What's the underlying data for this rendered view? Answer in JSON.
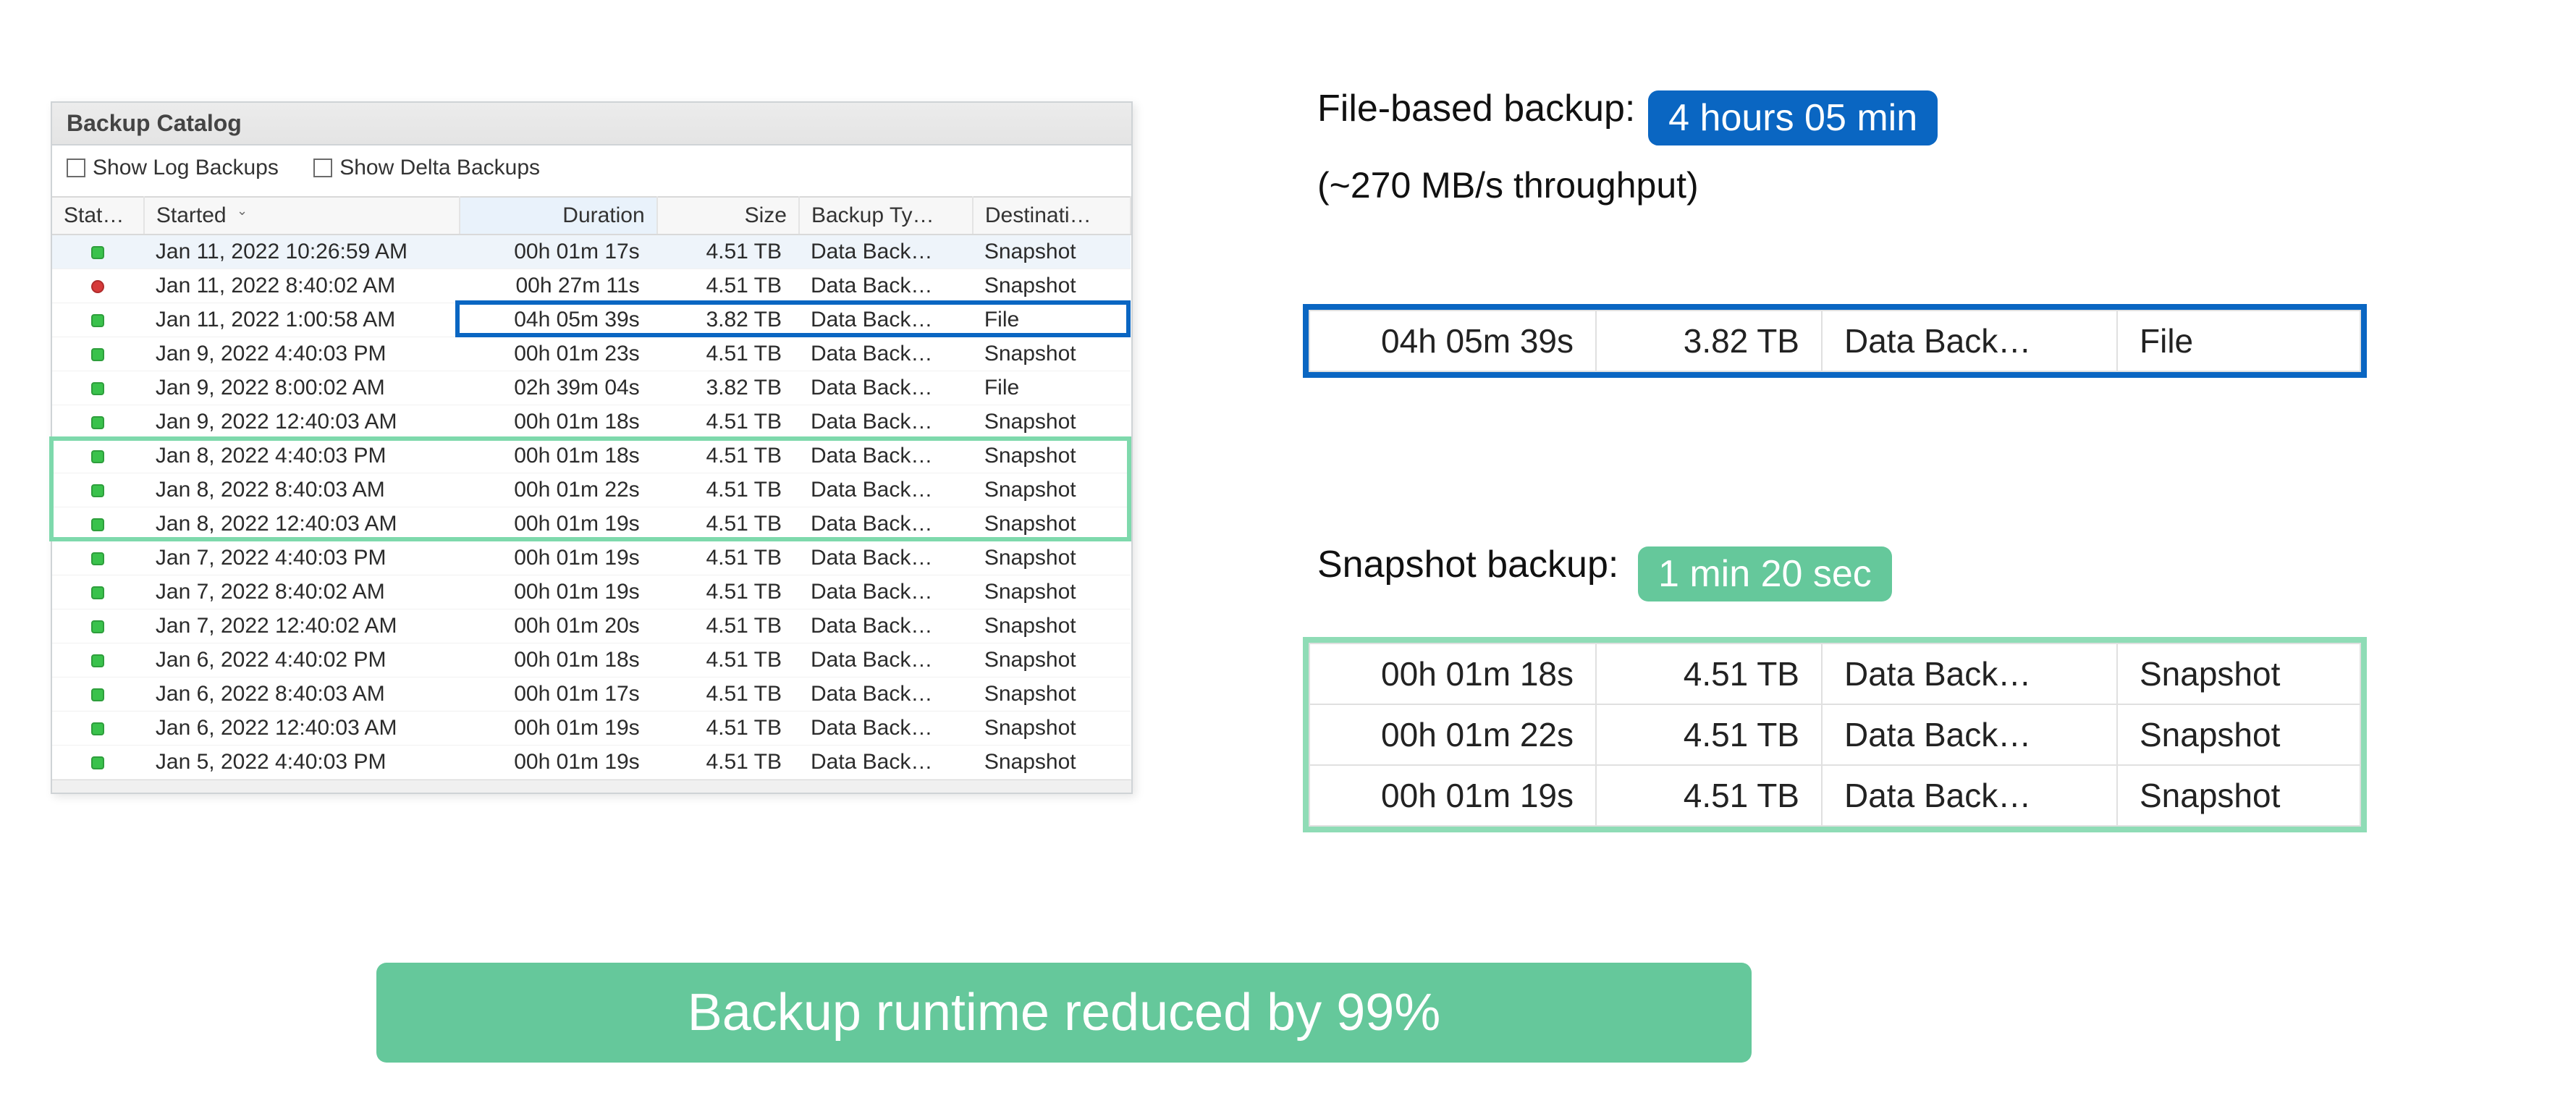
{
  "colors": {
    "blue": "#0a66c2",
    "green": "#65c89b",
    "green_light": "#8fdcb6"
  },
  "catalog": {
    "title": "Backup Catalog",
    "filters": {
      "show_log_backups": {
        "label": "Show Log Backups",
        "checked": false
      },
      "show_delta_backups": {
        "label": "Show Delta Backups",
        "checked": false
      }
    },
    "columns": {
      "status": "Stat…",
      "started": "Started",
      "duration": "Duration",
      "size": "Size",
      "backup_type": "Backup Ty…",
      "destination": "Destinati…"
    },
    "rows": [
      {
        "status": "ok",
        "started": "Jan 11, 2022 10:26:59 AM",
        "duration": "00h 01m 17s",
        "size": "4.51 TB",
        "type": "Data Back…",
        "dest": "Snapshot",
        "selected": true
      },
      {
        "status": "err",
        "started": "Jan 11, 2022 8:40:02 AM",
        "duration": "00h 27m 11s",
        "size": "4.51 TB",
        "type": "Data Back…",
        "dest": "Snapshot"
      },
      {
        "status": "ok",
        "started": "Jan 11, 2022 1:00:58 AM",
        "duration": "04h 05m 39s",
        "size": "3.82 TB",
        "type": "Data Back…",
        "dest": "File"
      },
      {
        "status": "ok",
        "started": "Jan 9, 2022 4:40:03 PM",
        "duration": "00h 01m 23s",
        "size": "4.51 TB",
        "type": "Data Back…",
        "dest": "Snapshot"
      },
      {
        "status": "ok",
        "started": "Jan 9, 2022 8:00:02 AM",
        "duration": "02h 39m 04s",
        "size": "3.82 TB",
        "type": "Data Back…",
        "dest": "File"
      },
      {
        "status": "ok",
        "started": "Jan 9, 2022 12:40:03 AM",
        "duration": "00h 01m 18s",
        "size": "4.51 TB",
        "type": "Data Back…",
        "dest": "Snapshot"
      },
      {
        "status": "ok",
        "started": "Jan 8, 2022 4:40:03 PM",
        "duration": "00h 01m 18s",
        "size": "4.51 TB",
        "type": "Data Back…",
        "dest": "Snapshot"
      },
      {
        "status": "ok",
        "started": "Jan 8, 2022 8:40:03 AM",
        "duration": "00h 01m 22s",
        "size": "4.51 TB",
        "type": "Data Back…",
        "dest": "Snapshot"
      },
      {
        "status": "ok",
        "started": "Jan 8, 2022 12:40:03 AM",
        "duration": "00h 01m 19s",
        "size": "4.51 TB",
        "type": "Data Back…",
        "dest": "Snapshot"
      },
      {
        "status": "ok",
        "started": "Jan 7, 2022 4:40:03 PM",
        "duration": "00h 01m 19s",
        "size": "4.51 TB",
        "type": "Data Back…",
        "dest": "Snapshot"
      },
      {
        "status": "ok",
        "started": "Jan 7, 2022 8:40:02 AM",
        "duration": "00h 01m 19s",
        "size": "4.51 TB",
        "type": "Data Back…",
        "dest": "Snapshot"
      },
      {
        "status": "ok",
        "started": "Jan 7, 2022 12:40:02 AM",
        "duration": "00h 01m 20s",
        "size": "4.51 TB",
        "type": "Data Back…",
        "dest": "Snapshot"
      },
      {
        "status": "ok",
        "started": "Jan 6, 2022 4:40:02 PM",
        "duration": "00h 01m 18s",
        "size": "4.51 TB",
        "type": "Data Back…",
        "dest": "Snapshot"
      },
      {
        "status": "ok",
        "started": "Jan 6, 2022 8:40:03 AM",
        "duration": "00h 01m 17s",
        "size": "4.51 TB",
        "type": "Data Back…",
        "dest": "Snapshot"
      },
      {
        "status": "ok",
        "started": "Jan 6, 2022 12:40:03 AM",
        "duration": "00h 01m 19s",
        "size": "4.51 TB",
        "type": "Data Back…",
        "dest": "Snapshot"
      },
      {
        "status": "ok",
        "started": "Jan 5, 2022 4:40:03 PM",
        "duration": "00h 01m 19s",
        "size": "4.51 TB",
        "type": "Data Back…",
        "dest": "Snapshot"
      }
    ]
  },
  "annotations": {
    "file_label": "File-based backup:",
    "file_badge": "4 hours 05 min",
    "file_throughput": "(~270 MB/s throughput)",
    "snapshot_label": "Snapshot backup:",
    "snapshot_badge": "1 min 20 sec",
    "banner": "Backup runtime reduced by 99%"
  },
  "zoom_file": {
    "rows": [
      {
        "duration": "04h 05m 39s",
        "size": "3.82 TB",
        "type": "Data Back…",
        "dest": "File"
      }
    ]
  },
  "zoom_snapshot": {
    "rows": [
      {
        "duration": "00h 01m 18s",
        "size": "4.51 TB",
        "type": "Data Back…",
        "dest": "Snapshot"
      },
      {
        "duration": "00h 01m 22s",
        "size": "4.51 TB",
        "type": "Data Back…",
        "dest": "Snapshot"
      },
      {
        "duration": "00h 01m 19s",
        "size": "4.51 TB",
        "type": "Data Back…",
        "dest": "Snapshot"
      }
    ]
  }
}
